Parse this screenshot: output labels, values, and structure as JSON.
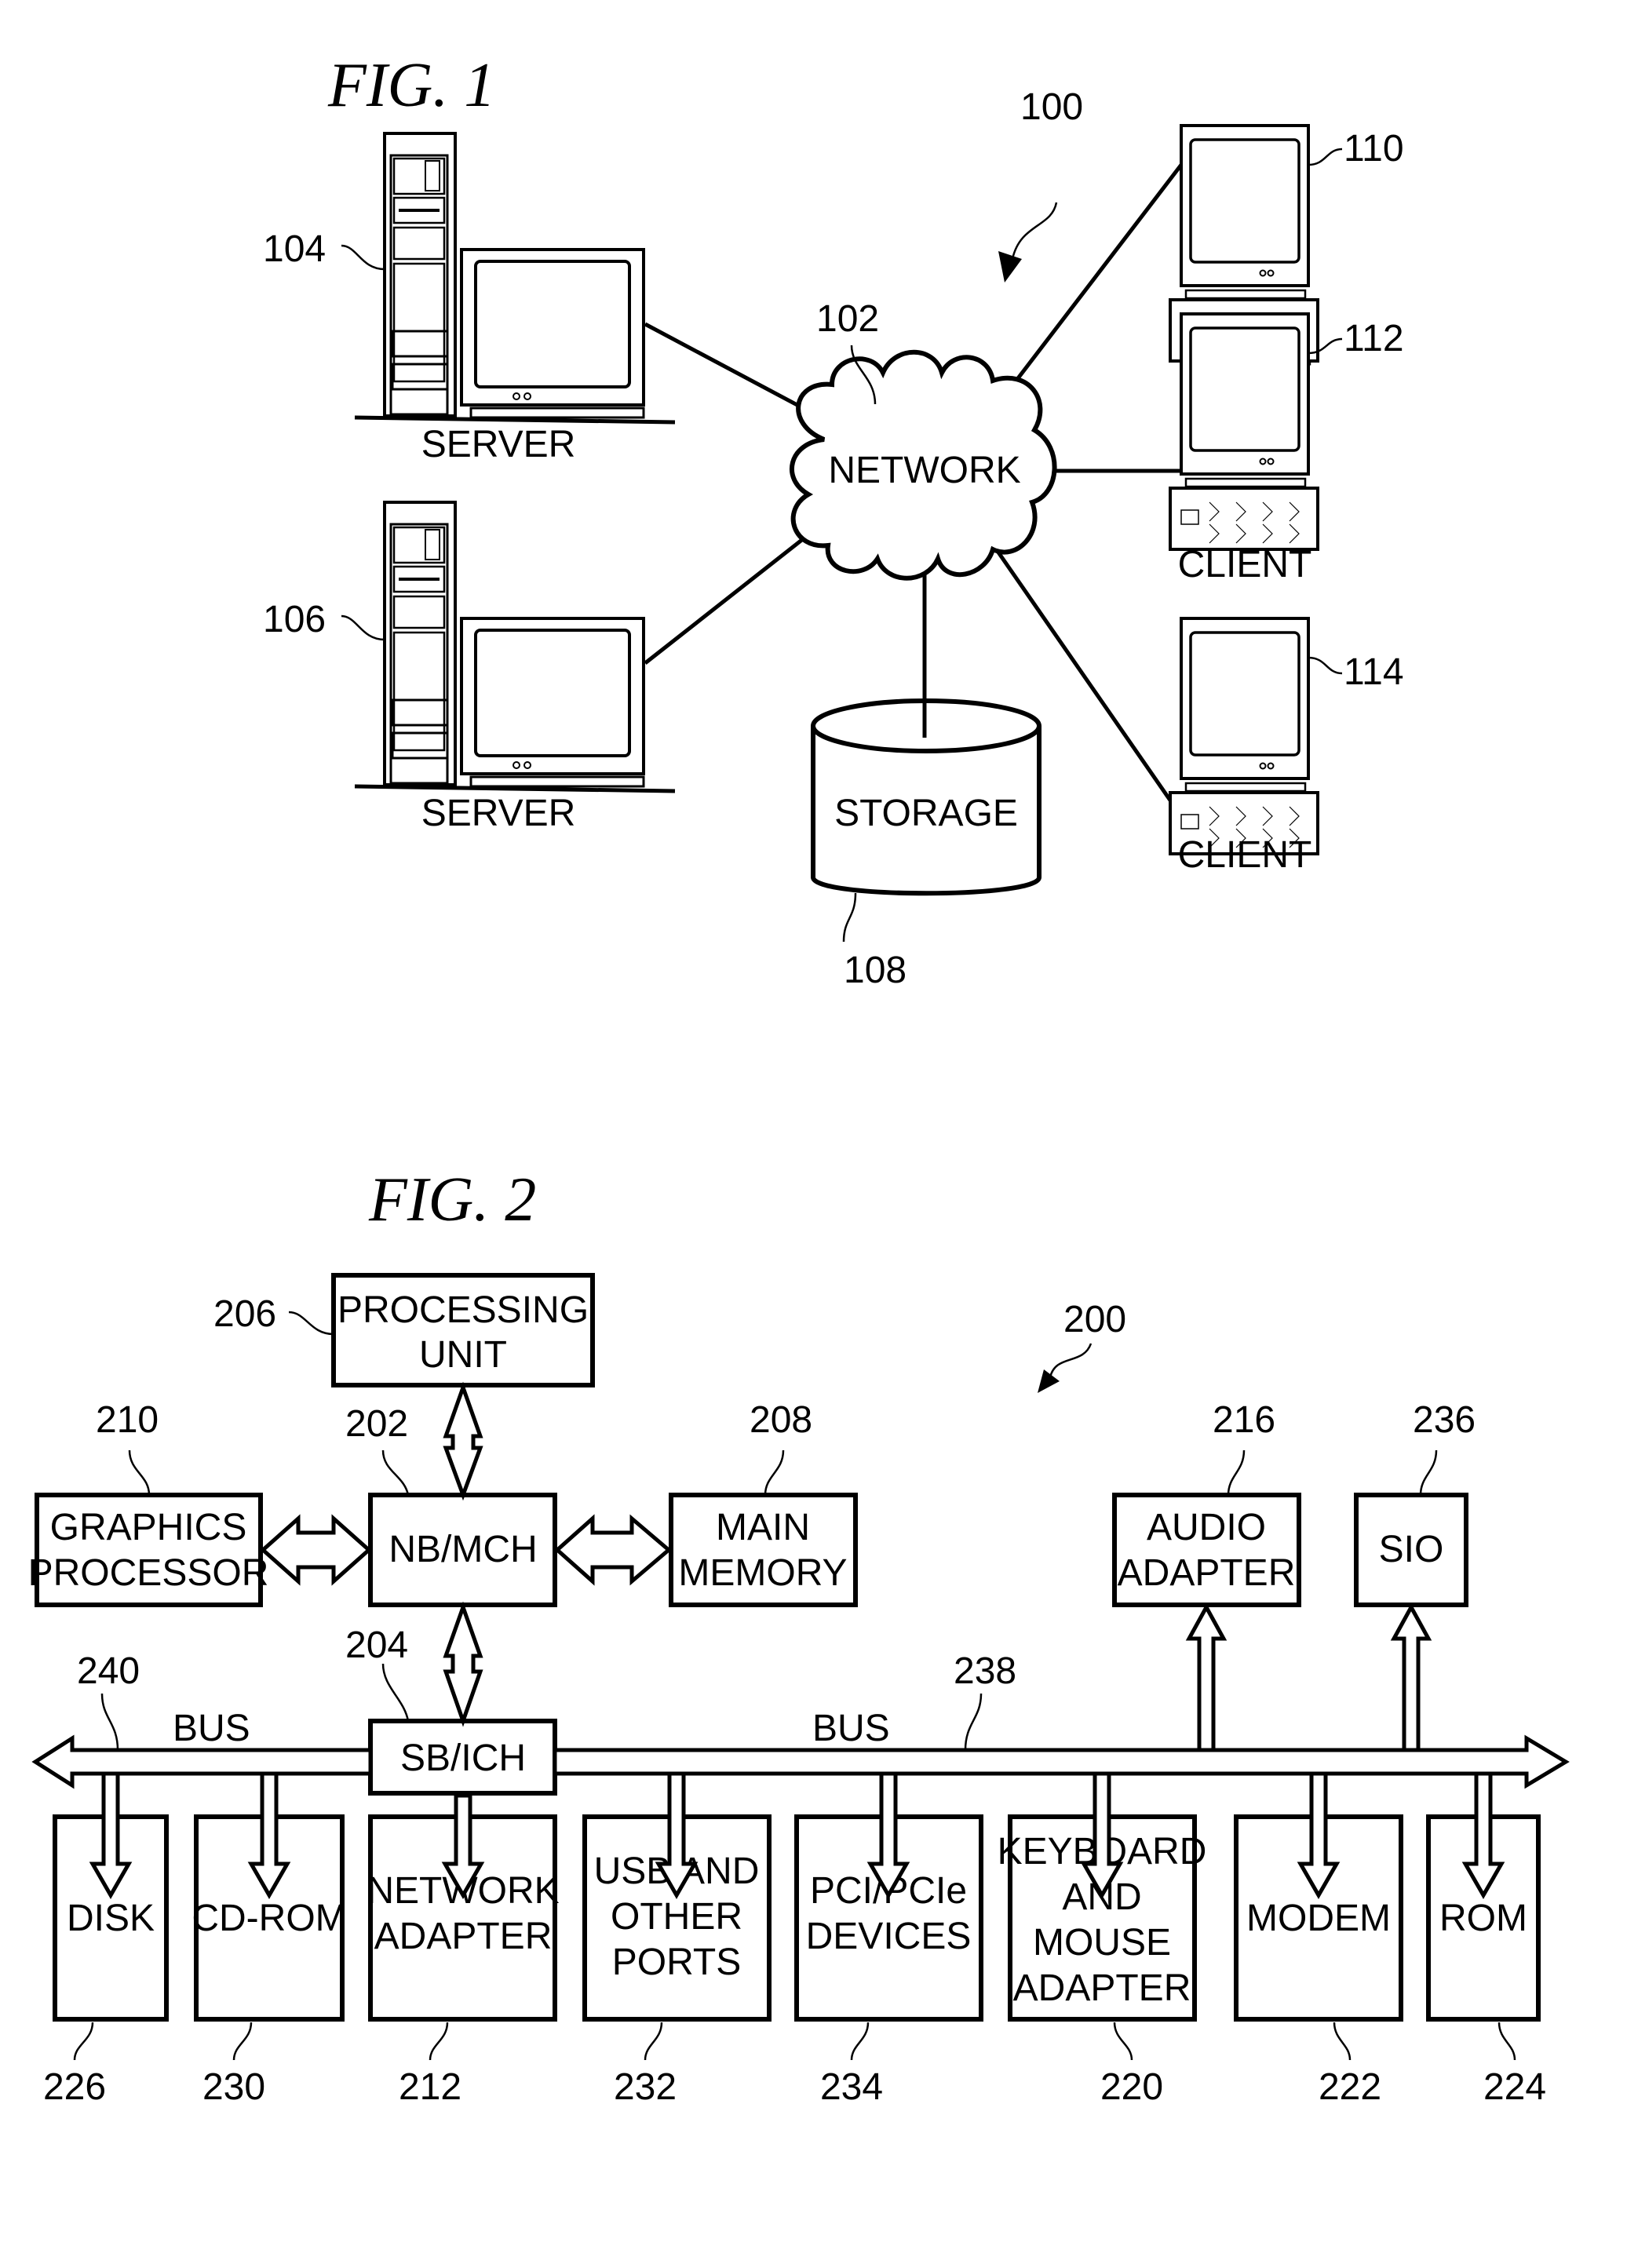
{
  "fig1": {
    "title": "FIG. 1",
    "system_ref": "100",
    "network": {
      "label": "NETWORK",
      "ref": "102"
    },
    "servers": [
      {
        "label": "SERVER",
        "ref": "104"
      },
      {
        "label": "SERVER",
        "ref": "106"
      }
    ],
    "storage": {
      "label": "STORAGE",
      "ref": "108"
    },
    "clients": [
      {
        "label": "CLIENT",
        "ref": "110"
      },
      {
        "label": "CLIENT",
        "ref": "112"
      },
      {
        "label": "CLIENT",
        "ref": "114"
      }
    ]
  },
  "fig2": {
    "title": "FIG. 2",
    "system_ref": "200",
    "processing_unit": {
      "line1": "PROCESSING",
      "line2": "UNIT",
      "ref": "206"
    },
    "nb_mch": {
      "label": "NB/MCH",
      "ref": "202"
    },
    "sb_ich": {
      "label": "SB/ICH",
      "ref": "204"
    },
    "graphics": {
      "line1": "GRAPHICS",
      "line2": "PROCESSOR",
      "ref": "210"
    },
    "main_memory": {
      "line1": "MAIN",
      "line2": "MEMORY",
      "ref": "208"
    },
    "audio": {
      "line1": "AUDIO",
      "line2": "ADAPTER",
      "ref": "216"
    },
    "sio": {
      "label": "SIO",
      "ref": "236"
    },
    "bus_left": {
      "label": "BUS",
      "ref": "240"
    },
    "bus_right": {
      "label": "BUS",
      "ref": "238"
    },
    "devices": [
      {
        "lines": [
          "DISK"
        ],
        "ref": "226"
      },
      {
        "lines": [
          "CD-ROM"
        ],
        "ref": "230"
      },
      {
        "lines": [
          "NETWORK",
          "ADAPTER"
        ],
        "ref": "212"
      },
      {
        "lines": [
          "USB AND",
          "OTHER",
          "PORTS"
        ],
        "ref": "232"
      },
      {
        "lines": [
          "PCI/PCIe",
          "DEVICES"
        ],
        "ref": "234"
      },
      {
        "lines": [
          "KEYBOARD",
          "AND",
          "MOUSE",
          "ADAPTER"
        ],
        "ref": "220"
      },
      {
        "lines": [
          "MODEM"
        ],
        "ref": "222"
      },
      {
        "lines": [
          "ROM"
        ],
        "ref": "224"
      }
    ]
  }
}
